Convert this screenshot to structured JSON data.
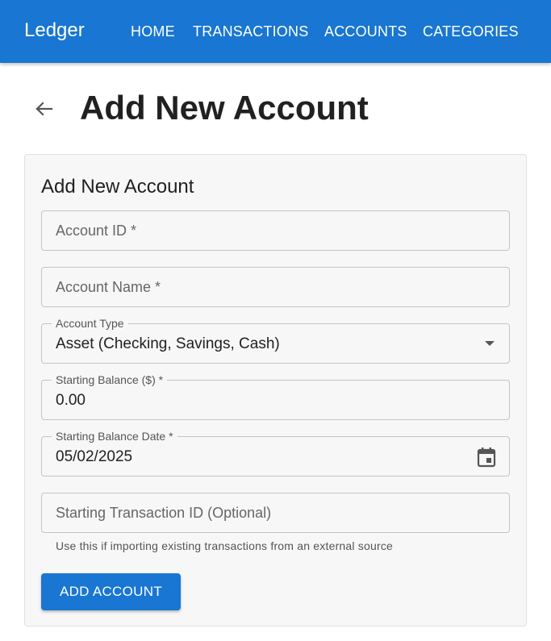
{
  "app": {
    "brand": "Ledger"
  },
  "nav": {
    "home": "HOME",
    "transactions": "TRANSACTIONS",
    "accounts": "ACCOUNTS",
    "categories": "CATEGORIES"
  },
  "page": {
    "title": "Add New Account",
    "back_icon": "arrow-left-icon"
  },
  "form": {
    "title": "Add New Account",
    "account_id": {
      "placeholder": "Account ID *",
      "value": ""
    },
    "account_name": {
      "placeholder": "Account Name *",
      "value": ""
    },
    "account_type": {
      "label": "Account Type",
      "value": "Asset (Checking, Savings, Cash)",
      "icon": "chevron-down-icon"
    },
    "starting_balance": {
      "label": "Starting Balance ($) *",
      "value": "0.00"
    },
    "starting_balance_date": {
      "label": "Starting Balance Date *",
      "value": "05/02/2025",
      "icon": "calendar-icon"
    },
    "starting_transaction_id": {
      "placeholder": "Starting Transaction ID (Optional)",
      "value": "",
      "helper": "Use this if importing existing transactions from an external source"
    },
    "submit_label": "ADD ACCOUNT"
  },
  "colors": {
    "primary": "#1976d2",
    "card_bg": "#f7f7f7",
    "border": "#c4c4c4"
  }
}
